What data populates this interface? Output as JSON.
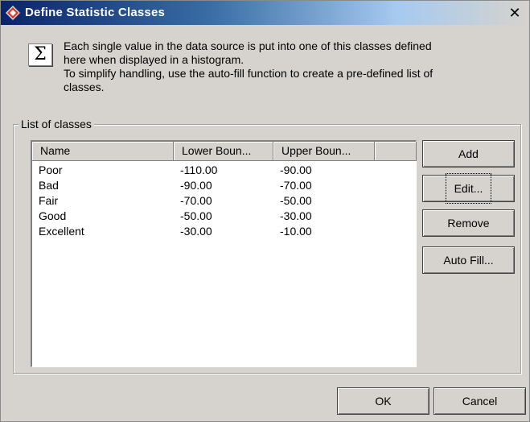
{
  "window": {
    "title": "Define Statistic Classes",
    "close_glyph": "✕",
    "title_icon": "red-diamond-icon",
    "titlebar_color": "#0a246a"
  },
  "info": {
    "icon": "sigma-icon",
    "icon_glyph": "Σ",
    "line1": "Each single value in the data source is put into one of this classes defined",
    "line2": "here when displayed in a histogram.",
    "line3": "To simplify handling, use the auto-fill function to create a pre-defined list of",
    "line4": "classes."
  },
  "group": {
    "legend": "List of classes"
  },
  "list": {
    "columns": [
      "Name",
      "Lower Boun...",
      "Upper Boun...",
      ""
    ],
    "rows": [
      {
        "name": "Poor",
        "lower": "-110.00",
        "upper": "-90.00"
      },
      {
        "name": "Bad",
        "lower": "-90.00",
        "upper": "-70.00"
      },
      {
        "name": "Fair",
        "lower": "-70.00",
        "upper": "-50.00"
      },
      {
        "name": "Good",
        "lower": "-50.00",
        "upper": "-30.00"
      },
      {
        "name": "Excellent",
        "lower": "-30.00",
        "upper": "-10.00"
      }
    ]
  },
  "buttons": {
    "add": "Add",
    "edit": "Edit...",
    "remove": "Remove",
    "auto_fill": "Auto Fill...",
    "ok": "OK",
    "cancel": "Cancel"
  }
}
